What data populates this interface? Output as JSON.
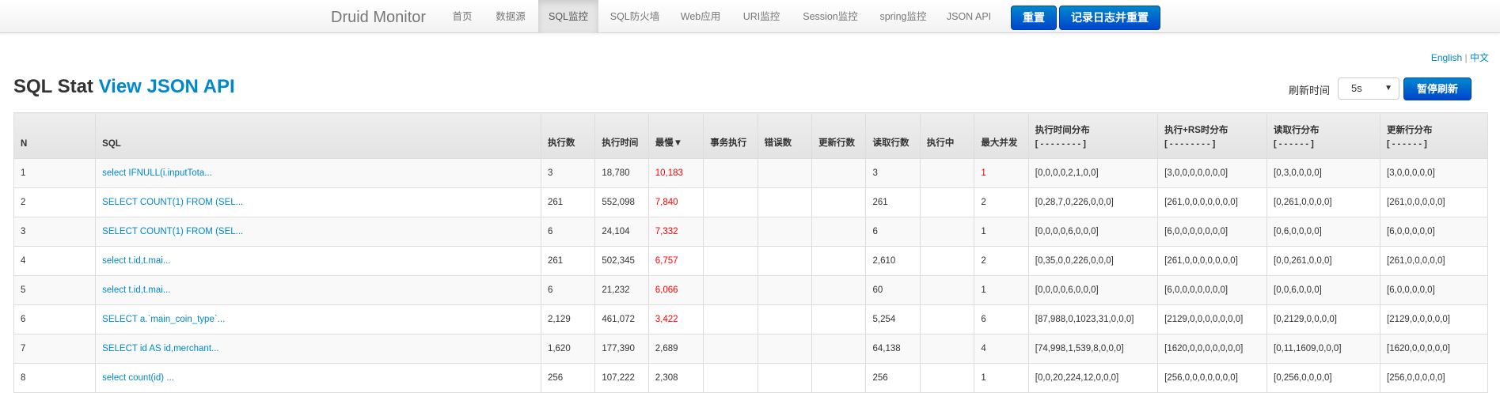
{
  "navbar": {
    "brand": "Druid Monitor",
    "items": [
      {
        "label": "首页"
      },
      {
        "label": "数据源"
      },
      {
        "label": "SQL监控"
      },
      {
        "label": "SQL防火墙"
      },
      {
        "label": "Web应用"
      },
      {
        "label": "URI监控"
      },
      {
        "label": "Session监控"
      },
      {
        "label": "spring监控"
      },
      {
        "label": "JSON API"
      }
    ],
    "active_item": "SQL监控",
    "reset_label": "重置",
    "log_reset_label": "记录日志并重置"
  },
  "lang": {
    "english": "English",
    "separator": "|",
    "chinese": "中文"
  },
  "page": {
    "title_prefix": "SQL Stat",
    "title_link": "View JSON API",
    "refresh_label": "刷新时间",
    "refresh_value": "5s",
    "pause_label": "暂停刷新"
  },
  "table": {
    "headers": [
      {
        "label": "N",
        "sub": ""
      },
      {
        "label": "SQL",
        "sub": ""
      },
      {
        "label": "执行数",
        "sub": ""
      },
      {
        "label": "执行时间",
        "sub": ""
      },
      {
        "label": "最慢▼",
        "sub": ""
      },
      {
        "label": "事务执行",
        "sub": ""
      },
      {
        "label": "错误数",
        "sub": ""
      },
      {
        "label": "更新行数",
        "sub": ""
      },
      {
        "label": "读取行数",
        "sub": ""
      },
      {
        "label": "执行中",
        "sub": ""
      },
      {
        "label": "最大并发",
        "sub": ""
      },
      {
        "label": "执行时间分布",
        "sub": "[ - - - - - - - - ]"
      },
      {
        "label": "执行+RS时分布",
        "sub": "[ - - - - - - - - ]"
      },
      {
        "label": "读取行分布",
        "sub": "[ - - - - - - ]"
      },
      {
        "label": "更新行分布",
        "sub": "[ - - - - - - ]"
      }
    ],
    "rows": [
      {
        "n": "1",
        "sql": "select IFNULL(i.inputTota...",
        "exec": "3",
        "time": "18,780",
        "slowest": "10,183",
        "tx": "",
        "err": "",
        "upd": "",
        "read": "3",
        "running": "",
        "concurrent": "1",
        "time_dist": "[0,0,0,0,2,1,0,0]",
        "rs_dist": "[3,0,0,0,0,0,0,0]",
        "read_dist": "[0,3,0,0,0,0]",
        "upd_dist": "[3,0,0,0,0,0]"
      },
      {
        "n": "2",
        "sql": "SELECT COUNT(1) FROM (SEL...",
        "exec": "261",
        "time": "552,098",
        "slowest": "7,840",
        "tx": "",
        "err": "",
        "upd": "",
        "read": "261",
        "running": "",
        "concurrent": "2",
        "time_dist": "[0,28,7,0,226,0,0,0]",
        "rs_dist": "[261,0,0,0,0,0,0,0]",
        "read_dist": "[0,261,0,0,0,0]",
        "upd_dist": "[261,0,0,0,0,0]"
      },
      {
        "n": "3",
        "sql": "SELECT COUNT(1) FROM (SEL...",
        "exec": "6",
        "time": "24,104",
        "slowest": "7,332",
        "tx": "",
        "err": "",
        "upd": "",
        "read": "6",
        "running": "",
        "concurrent": "1",
        "time_dist": "[0,0,0,0,6,0,0,0]",
        "rs_dist": "[6,0,0,0,0,0,0,0]",
        "read_dist": "[0,6,0,0,0,0]",
        "upd_dist": "[6,0,0,0,0,0]"
      },
      {
        "n": "4",
        "sql": "select t.id,t.mai...",
        "exec": "261",
        "time": "502,345",
        "slowest": "6,757",
        "tx": "",
        "err": "",
        "upd": "",
        "read": "2,610",
        "running": "",
        "concurrent": "2",
        "time_dist": "[0,35,0,0,226,0,0,0]",
        "rs_dist": "[261,0,0,0,0,0,0,0]",
        "read_dist": "[0,0,261,0,0,0]",
        "upd_dist": "[261,0,0,0,0,0]"
      },
      {
        "n": "5",
        "sql": "select t.id,t.mai...",
        "exec": "6",
        "time": "21,232",
        "slowest": "6,066",
        "tx": "",
        "err": "",
        "upd": "",
        "read": "60",
        "running": "",
        "concurrent": "1",
        "time_dist": "[0,0,0,0,6,0,0,0]",
        "rs_dist": "[6,0,0,0,0,0,0,0]",
        "read_dist": "[0,0,6,0,0,0]",
        "upd_dist": "[6,0,0,0,0,0]"
      },
      {
        "n": "6",
        "sql": "SELECT a.`main_coin_type`...",
        "exec": "2,129",
        "time": "461,072",
        "slowest": "3,422",
        "tx": "",
        "err": "",
        "upd": "",
        "read": "5,254",
        "running": "",
        "concurrent": "6",
        "time_dist": "[87,988,0,1023,31,0,0,0]",
        "rs_dist": "[2129,0,0,0,0,0,0,0]",
        "read_dist": "[0,2129,0,0,0,0]",
        "upd_dist": "[2129,0,0,0,0,0]"
      },
      {
        "n": "7",
        "sql": "SELECT id AS id,merchant...",
        "exec": "1,620",
        "time": "177,390",
        "slowest": "2,689",
        "tx": "",
        "err": "",
        "upd": "",
        "read": "64,138",
        "running": "",
        "concurrent": "4",
        "time_dist": "[74,998,1,539,8,0,0,0]",
        "rs_dist": "[1620,0,0,0,0,0,0,0]",
        "read_dist": "[0,11,1609,0,0,0]",
        "upd_dist": "[1620,0,0,0,0,0]"
      },
      {
        "n": "8",
        "sql": "select count(id) ...",
        "exec": "256",
        "time": "107,222",
        "slowest": "2,308",
        "tx": "",
        "err": "",
        "upd": "",
        "read": "256",
        "running": "",
        "concurrent": "1",
        "time_dist": "[0,0,20,224,12,0,0,0]",
        "rs_dist": "[256,0,0,0,0,0,0,0]",
        "read_dist": "[0,256,0,0,0,0]",
        "upd_dist": "[256,0,0,0,0,0]"
      }
    ],
    "slowest_red_rows": [
      1,
      2,
      3,
      4,
      5,
      6
    ],
    "max_concurrent_red_rows": [
      1
    ]
  },
  "colors": {
    "link": "#0088cc",
    "danger": "#ff0000",
    "primary_button": "#0055cc"
  }
}
